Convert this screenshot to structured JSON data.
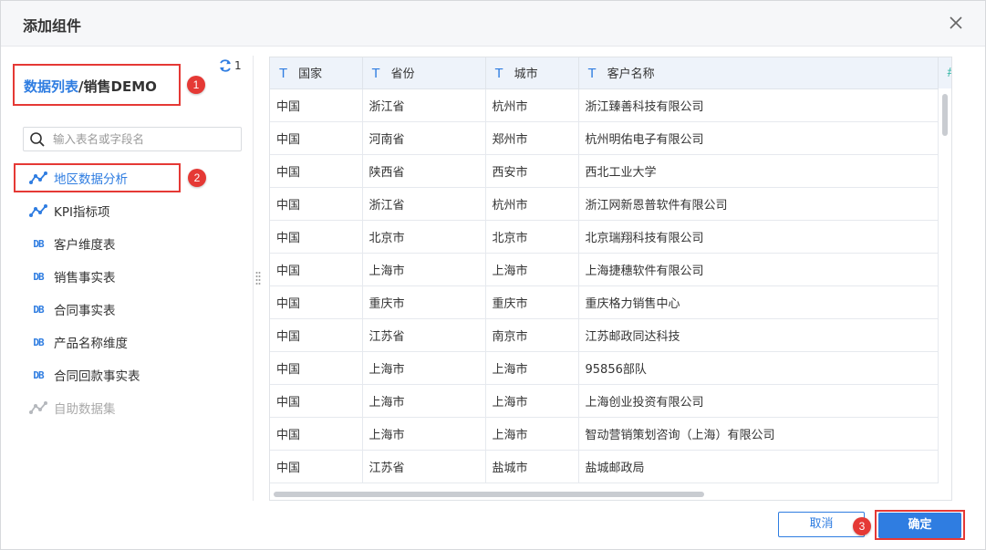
{
  "dialog": {
    "title": "添加组件"
  },
  "left": {
    "refresh_count": "1",
    "breadcrumb": {
      "root": "数据列表",
      "separator": "/",
      "current": "销售DEMO"
    },
    "search_placeholder": "输入表名或字段名",
    "items": [
      {
        "label": "地区数据分析",
        "icon": "dataset-link-icon"
      },
      {
        "label": "KPI指标项",
        "icon": "dataset-link-icon"
      },
      {
        "label": "客户维度表",
        "icon": "database-table-icon"
      },
      {
        "label": "销售事实表",
        "icon": "database-table-icon"
      },
      {
        "label": "合同事实表",
        "icon": "database-table-icon"
      },
      {
        "label": "产品名称维度",
        "icon": "database-table-icon"
      },
      {
        "label": "合同回款事实表",
        "icon": "database-table-icon"
      },
      {
        "label": "自助数据集",
        "icon": "dataset-link-icon"
      }
    ],
    "db_glyph": "DB"
  },
  "annotations": {
    "one": "1",
    "two": "2",
    "three": "3"
  },
  "table": {
    "type_glyph": "T",
    "columns": [
      "国家",
      "省份",
      "城市",
      "客户名称"
    ],
    "rows": [
      [
        "中国",
        "浙江省",
        "杭州市",
        "浙江臻善科技有限公司"
      ],
      [
        "中国",
        "河南省",
        "郑州市",
        "杭州明佑电子有限公司"
      ],
      [
        "中国",
        "陕西省",
        "西安市",
        "西北工业大学"
      ],
      [
        "中国",
        "浙江省",
        "杭州市",
        "浙江网新恩普软件有限公司"
      ],
      [
        "中国",
        "北京市",
        "北京市",
        "北京瑞翔科技有限公司"
      ],
      [
        "中国",
        "上海市",
        "上海市",
        "上海捷穗软件有限公司"
      ],
      [
        "中国",
        "重庆市",
        "重庆市",
        "重庆格力销售中心"
      ],
      [
        "中国",
        "江苏省",
        "南京市",
        "江苏邮政同达科技"
      ],
      [
        "中国",
        "上海市",
        "上海市",
        "95856部队"
      ],
      [
        "中国",
        "上海市",
        "上海市",
        "上海创业投资有限公司"
      ],
      [
        "中国",
        "上海市",
        "上海市",
        "智动营销策划咨询（上海）有限公司"
      ],
      [
        "中国",
        "江苏省",
        "盐城市",
        "盐城邮政局"
      ]
    ]
  },
  "footer": {
    "cancel_label": "取消",
    "ok_label": "确定"
  },
  "colors": {
    "accent": "#2f7de1",
    "highlight": "#e53935"
  }
}
